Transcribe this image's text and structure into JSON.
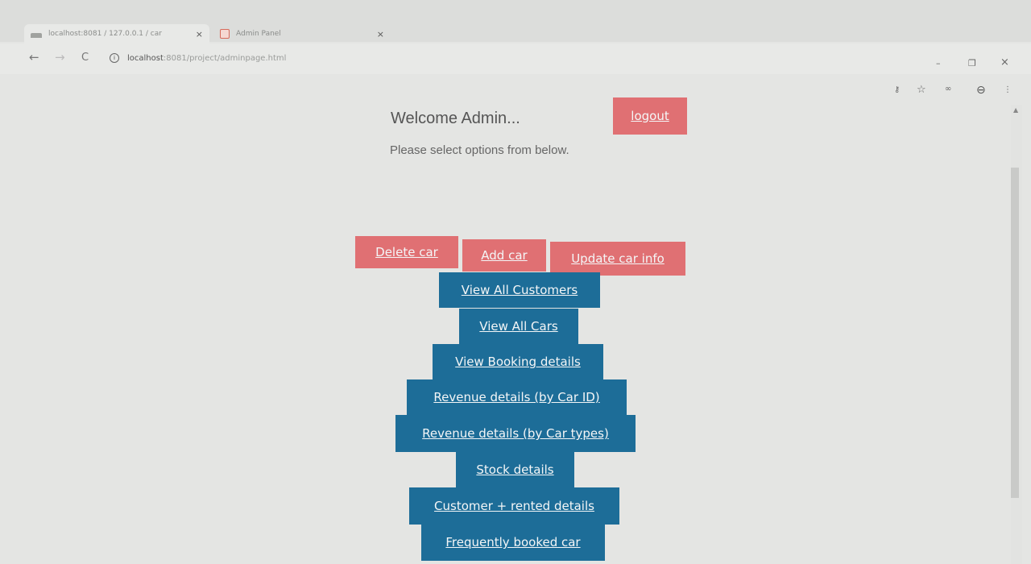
{
  "browser": {
    "tabs": [
      {
        "title": "localhost:8081 / 127.0.0.1 / car",
        "close": "×"
      },
      {
        "title": "Admin Panel",
        "close": "×"
      }
    ],
    "new_tab": "+",
    "url_host": "localhost",
    "url_rest": ":8081/project/adminpage.html",
    "window_controls": {
      "minimize": "–",
      "maximize": "❐",
      "close": "×"
    },
    "nav": {
      "back": "←",
      "forward": "→",
      "reload": "C"
    },
    "toolbar_icons": {
      "key": "⚷",
      "star": "☆",
      "extension": "∞",
      "profile": "⊖",
      "menu": "⋮"
    }
  },
  "page": {
    "welcome": "Welcome Admin...",
    "subtitle": "Please select options from below.",
    "logout_label": "logout",
    "actions_row": [
      "Delete car",
      "Add car",
      "Update car info"
    ],
    "menu": [
      "View All Customers",
      "View All Cars",
      "View Booking details",
      "Revenue details (by Car ID)",
      "Revenue details (by Car types)",
      "Stock details",
      "Customer + rented details",
      "Frequently booked car"
    ]
  },
  "colors": {
    "red_button": "#e07073",
    "blue_button": "#1d6d98"
  }
}
